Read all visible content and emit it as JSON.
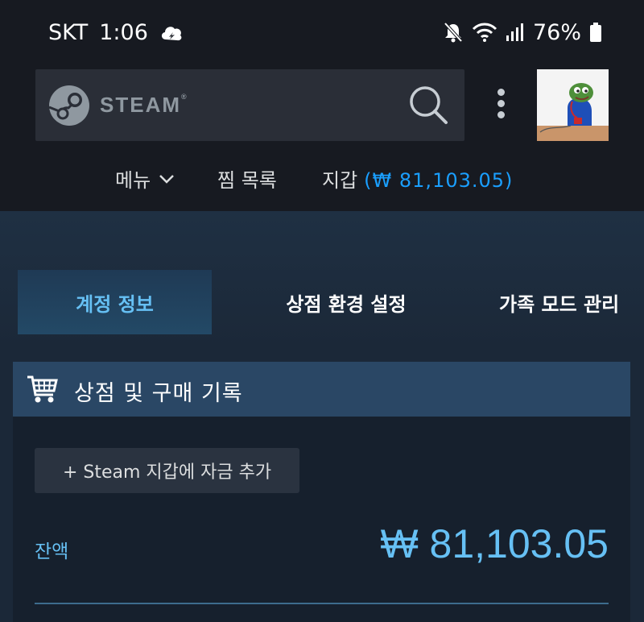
{
  "status_bar": {
    "carrier": "SKT",
    "time": "1:06",
    "battery": "76%",
    "icons": [
      "cloud-icon",
      "mute-icon",
      "wifi-icon",
      "signal-icon",
      "battery-icon"
    ]
  },
  "header": {
    "brand": "STEAM",
    "brand_mark": "®"
  },
  "nav": {
    "menu_label": "메뉴",
    "wishlist_label": "찜 목록",
    "wallet_label": "지갑",
    "wallet_balance": "(₩ 81,103.05)"
  },
  "tabs": [
    {
      "label": "계정 정보",
      "active": true
    },
    {
      "label": "상점 환경 설정",
      "active": false
    },
    {
      "label": "가족 모드 관리",
      "active": false
    }
  ],
  "store_section": {
    "title": "상점 및 구매 기록",
    "add_funds_label": "+ Steam 지갑에 자금 추가",
    "balance_label": "잔액",
    "balance_value": "₩ 81,103.05"
  },
  "colors": {
    "accent": "#66c0f4",
    "wallet_blue": "#1a9fff",
    "header_bg": "#171a21",
    "page_bg": "#1b2838",
    "section_header_bg": "#2a4765"
  }
}
